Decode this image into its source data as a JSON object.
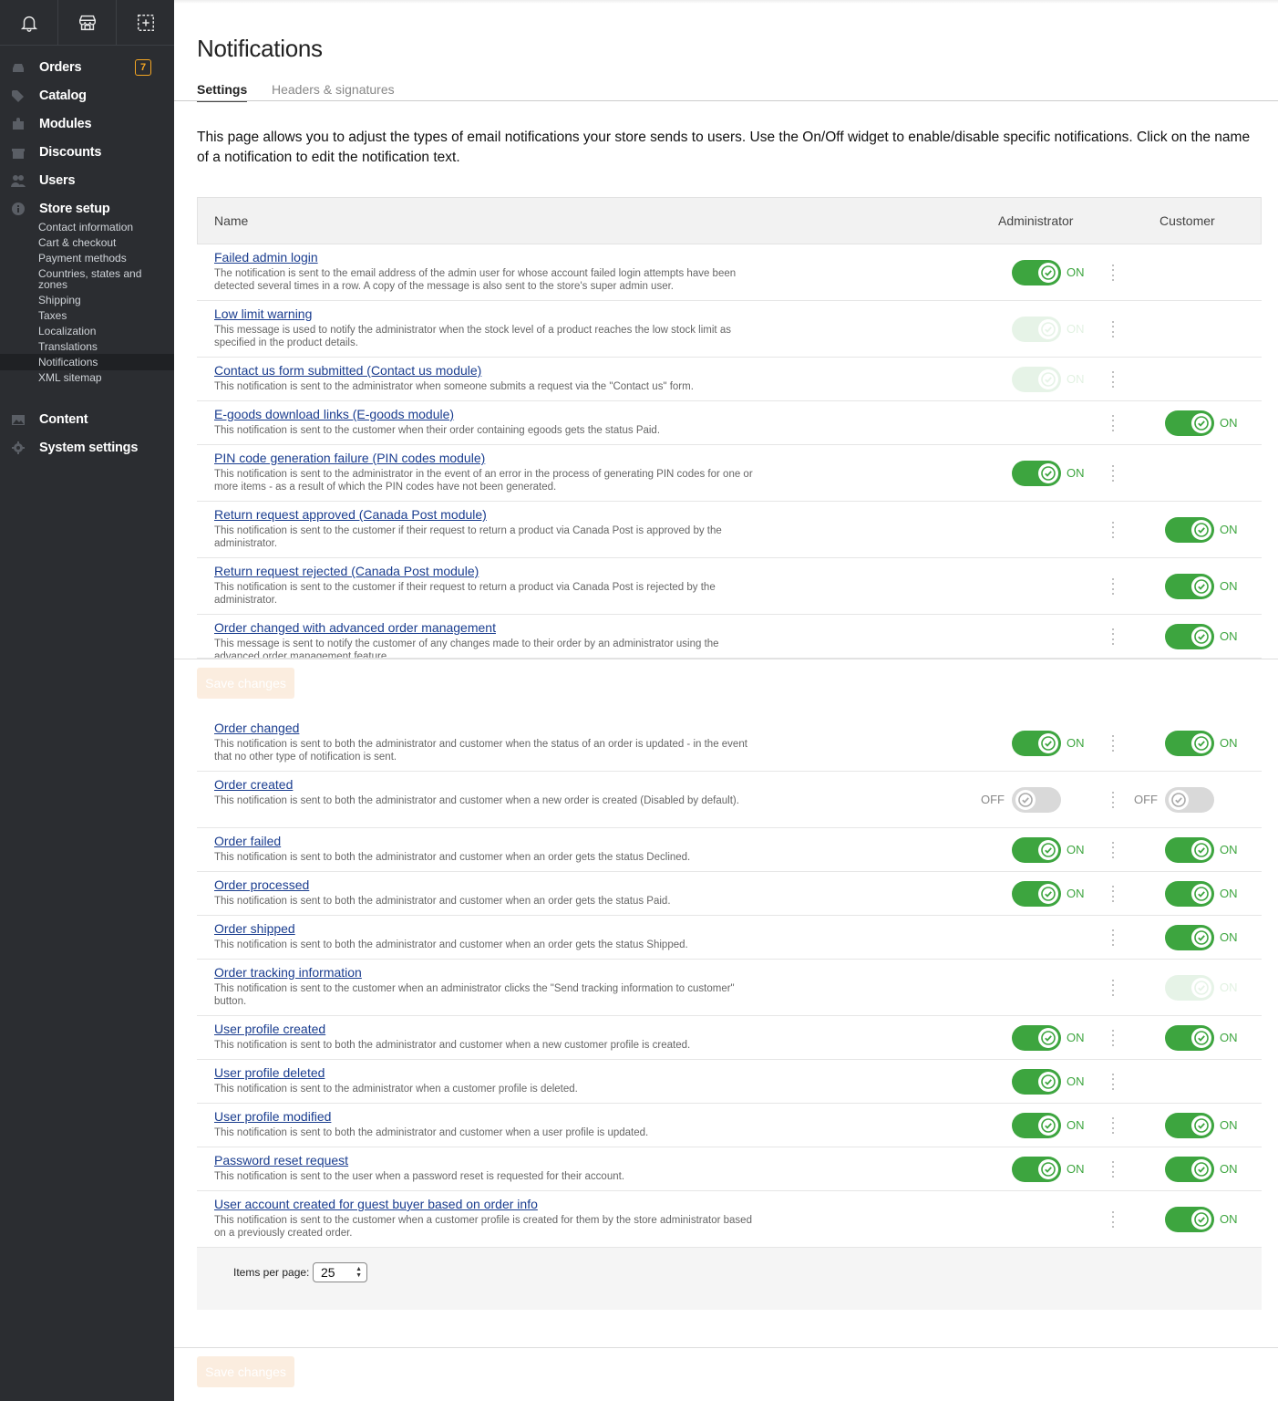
{
  "sidebar": {
    "top_icons": [
      "bell-icon",
      "store-icon",
      "add-icon"
    ],
    "nav": [
      {
        "label": "Orders",
        "icon": "inbox-icon",
        "badge": "7"
      },
      {
        "label": "Catalog",
        "icon": "tag-icon"
      },
      {
        "label": "Modules",
        "icon": "puzzle-icon"
      },
      {
        "label": "Discounts",
        "icon": "gift-icon"
      },
      {
        "label": "Users",
        "icon": "users-icon"
      },
      {
        "label": "Store setup",
        "icon": "info-icon"
      }
    ],
    "sub_items": [
      "Contact information",
      "Cart & checkout",
      "Payment methods",
      "Countries, states and zones",
      "Shipping",
      "Taxes",
      "Localization",
      "Translations",
      "Notifications",
      "XML sitemap"
    ],
    "active_sub": "Notifications",
    "nav2": [
      {
        "label": "Content",
        "icon": "image-icon"
      },
      {
        "label": "System settings",
        "icon": "gear-icon"
      }
    ]
  },
  "page": {
    "title": "Notifications",
    "tabs": [
      {
        "label": "Settings",
        "active": true
      },
      {
        "label": "Headers & signatures",
        "active": false
      }
    ],
    "intro": "This page allows you to adjust the types of email notifications your store sends to users. Use the On/Off widget to enable/disable specific notifications. Click on the name of a notification to edit the notification text."
  },
  "table": {
    "headers": {
      "name": "Name",
      "admin": "Administrator",
      "customer": "Customer"
    },
    "on_label": "ON",
    "off_label": "OFF",
    "rows": [
      {
        "title": "Failed admin login",
        "desc": "The notification is sent to the email address of the admin user for whose account failed login attempts have been detected several times in a row. A copy of the message is also sent to the store's super admin user.",
        "admin": "on",
        "customer": null
      },
      {
        "title": "Low limit warning",
        "desc": "This message is used to notify the administrator when the stock level of a product reaches the low stock limit as specified in the product details.",
        "admin": "dim",
        "customer": null
      },
      {
        "title": "Contact us form submitted (Contact us module)",
        "desc": "This notification is sent to the administrator when someone submits a request via the \"Contact us\" form.",
        "admin": "dim",
        "customer": null
      },
      {
        "title": "E-goods download links (E-goods module)",
        "desc": "This notification is sent to the customer when their order containing egoods gets the status Paid.",
        "admin": null,
        "customer": "on"
      },
      {
        "title": "PIN code generation failure (PIN codes module)",
        "desc": "This notification is sent to the administrator in the event of an error in the process of generating PIN codes for one or more items - as a result of which the PIN codes have not been generated.",
        "admin": "on",
        "customer": null
      },
      {
        "title": "Return request approved (Canada Post module)",
        "desc": "This notification is sent to the customer if their request to return a product via Canada Post is approved by the administrator.",
        "admin": null,
        "customer": "on"
      },
      {
        "title": "Return request rejected (Canada Post module)",
        "desc": "This notification is sent to the customer if their request to return a product via Canada Post is rejected by the administrator.",
        "admin": null,
        "customer": "on"
      },
      {
        "title": "Order changed with advanced order management",
        "desc": "This message is sent to notify the customer of any changes made to their order by an administrator using the advanced order management feature.",
        "admin": null,
        "customer": "on"
      },
      {
        "title": "Order changed",
        "desc": "This notification is sent to both the administrator and customer when the status of an order is updated - in the event that no other type of notification is sent.",
        "admin": "on",
        "customer": "on"
      },
      {
        "title": "Order created",
        "desc": "This notification is sent to both the administrator and customer when a new order is created (Disabled by default).",
        "admin": "off",
        "customer": "off"
      },
      {
        "title": "Order failed",
        "desc": "This notification is sent to both the administrator and customer when an order gets the status Declined.",
        "admin": "on",
        "customer": "on"
      },
      {
        "title": "Order processed",
        "desc": "This notification is sent to both the administrator and customer when an order gets the status Paid.",
        "admin": "on",
        "customer": "on"
      },
      {
        "title": "Order shipped",
        "desc": "This notification is sent to both the administrator and customer when an order gets the status Shipped.",
        "admin": null,
        "customer": "on"
      },
      {
        "title": "Order tracking information",
        "desc": "This notification is sent to the customer when an administrator clicks the \"Send tracking information to customer\" button.",
        "admin": null,
        "customer": "dim"
      },
      {
        "title": "User profile created",
        "desc": "This notification is sent to both the administrator and customer when a new customer profile is created.",
        "admin": "on",
        "customer": "on"
      },
      {
        "title": "User profile deleted",
        "desc": "This notification is sent to the administrator when a customer profile is deleted.",
        "admin": "on",
        "customer": null
      },
      {
        "title": "User profile modified",
        "desc": "This notification is sent to both the administrator and customer when a user profile is updated.",
        "admin": "on",
        "customer": "on"
      },
      {
        "title": "Password reset request",
        "desc": "This notification is sent to the user when a password reset is requested for their account.",
        "admin": "on",
        "customer": "on"
      },
      {
        "title": "User account created for guest buyer based on order info",
        "desc": "This notification is sent to the customer when a customer profile is created for them by the store administrator based on a previously created order.",
        "admin": null,
        "customer": "on"
      }
    ]
  },
  "footer": {
    "items_per_page_label": "Items per page:",
    "items_per_page_value": "25"
  },
  "buttons": {
    "save": "Save changes"
  },
  "colors": {
    "sidebar_bg": "#2b2d31",
    "toggle_on": "#3da53f",
    "link": "#1a3d8f",
    "badge": "#f5a623"
  }
}
